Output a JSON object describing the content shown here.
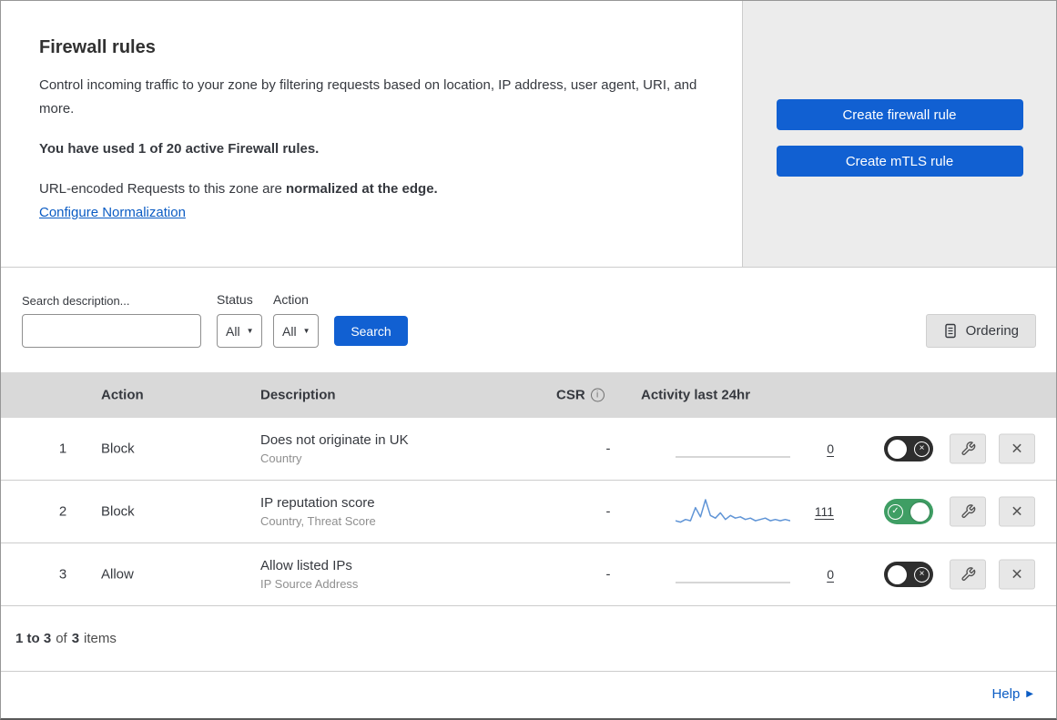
{
  "header": {
    "title": "Firewall rules",
    "description": "Control incoming traffic to your zone by filtering requests based on location, IP address, user agent, URI, and more.",
    "usage": "You have used 1 of 20 active Firewall rules.",
    "normalization_prefix": "URL-encoded Requests to this zone are ",
    "normalization_bold": "normalized at the edge.",
    "normalization_link": "Configure Normalization",
    "create_firewall_label": "Create firewall rule",
    "create_mtls_label": "Create mTLS rule"
  },
  "filters": {
    "search_label": "Search description...",
    "search_value": "",
    "status_label": "Status",
    "status_value": "All",
    "action_label": "Action",
    "action_value": "All",
    "search_button_label": "Search",
    "ordering_button_label": "Ordering"
  },
  "table": {
    "headers": {
      "action": "Action",
      "description": "Description",
      "csr": "CSR",
      "activity": "Activity last 24hr"
    },
    "rows": [
      {
        "index": "1",
        "action": "Block",
        "description": "Does not originate in UK",
        "criteria": "Country",
        "csr": "-",
        "activity_count": "0",
        "enabled": false,
        "sparkline": []
      },
      {
        "index": "2",
        "action": "Block",
        "description": "IP reputation score",
        "criteria": "Country, Threat Score",
        "csr": "-",
        "activity_count": "111",
        "enabled": true,
        "sparkline": [
          2,
          1,
          3,
          2,
          12,
          5,
          18,
          6,
          4,
          8,
          3,
          6,
          4,
          5,
          3,
          4,
          2,
          3,
          4,
          2,
          3,
          2,
          3,
          2
        ]
      },
      {
        "index": "3",
        "action": "Allow",
        "description": "Allow listed IPs",
        "criteria": "IP Source Address",
        "csr": "-",
        "activity_count": "0",
        "enabled": false,
        "sparkline": []
      }
    ],
    "footer": {
      "range": "1 to 3",
      "of_label": "of",
      "total": "3",
      "items_label": "items"
    }
  },
  "help": {
    "label": "Help"
  },
  "icons": {
    "dropdown_arrow": "▼",
    "help_arrow": "▶",
    "toggle_on_glyph": "✓",
    "toggle_off_glyph": "×",
    "close_glyph": "×",
    "info_glyph": "i"
  },
  "colors": {
    "primary_blue": "#1160d2",
    "link_blue": "#0b5cc4",
    "toggle_green": "#3f9e64",
    "toggle_off": "#2e2e2e",
    "sparkline": "#5f94d6",
    "flatline": "#c9c9c9"
  }
}
